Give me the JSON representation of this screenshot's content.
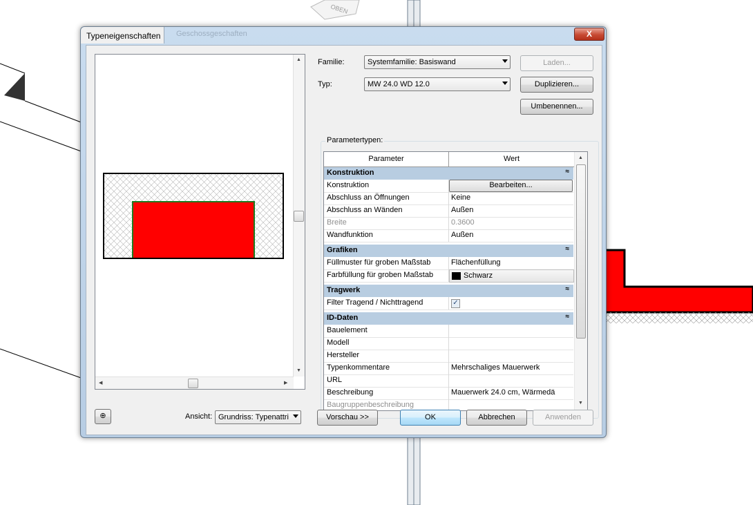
{
  "window": {
    "title": "Typeneigenschaften",
    "ghost_title": "Geschossgeschaften",
    "close_label": "X",
    "viewcube_label": "OBEN"
  },
  "family": {
    "label": "Familie:",
    "value": "Systemfamilie: Basiswand"
  },
  "type": {
    "label": "Typ:",
    "value": "MW 24.0 WD 12.0"
  },
  "buttons": {
    "load": "Laden...",
    "duplicate": "Duplizieren...",
    "rename": "Umbenennen...",
    "preview": "Vorschau >>",
    "ok": "OK",
    "cancel": "Abbrechen",
    "apply": "Anwenden"
  },
  "params_group_label": "Parametertypen:",
  "grid": {
    "col_parameter": "Parameter",
    "col_value": "Wert",
    "collapse_glyph": "≈",
    "sections": {
      "konstruktion": "Konstruktion",
      "grafiken": "Grafiken",
      "tragwerk": "Tragwerk",
      "iddaten": "ID-Daten"
    },
    "rows": {
      "konstruktion": {
        "name": "Konstruktion",
        "value": "Bearbeiten..."
      },
      "abschluss_oeffnungen": {
        "name": "Abschluss an Öffnungen",
        "value": "Keine"
      },
      "abschluss_waenden": {
        "name": "Abschluss an Wänden",
        "value": "Außen"
      },
      "breite": {
        "name": "Breite",
        "value": "0.3600"
      },
      "wandfunktion": {
        "name": "Wandfunktion",
        "value": "Außen"
      },
      "fuellmuster": {
        "name": "Füllmuster für groben Maßstab",
        "value": "Flächenfüllung"
      },
      "farbfuellung": {
        "name": "Farbfüllung für groben Maßstab",
        "value": "Schwarz",
        "swatch_color": "#000000"
      },
      "filter_tragend": {
        "name": "Filter Tragend / Nichttragend",
        "checked": true,
        "check_glyph": "✓"
      },
      "bauelement": {
        "name": "Bauelement",
        "value": ""
      },
      "modell": {
        "name": "Modell",
        "value": ""
      },
      "hersteller": {
        "name": "Hersteller",
        "value": ""
      },
      "typenkommentare": {
        "name": "Typenkommentare",
        "value": "Mehrschaliges Mauerwerk"
      },
      "url": {
        "name": "URL",
        "value": ""
      },
      "beschreibung": {
        "name": "Beschreibung",
        "value": "Mauerwerk 24.0 cm, Wärmedä"
      },
      "baugruppen": {
        "name": "Baugruppenbeschreibung",
        "value": ""
      }
    }
  },
  "view": {
    "label": "Ansicht:",
    "value": "Grundriss: Typenattri"
  },
  "colors": {
    "preview_fill": "#ff0000",
    "section_bg": "#b8cde1",
    "wall_fill": "#ff0000"
  }
}
